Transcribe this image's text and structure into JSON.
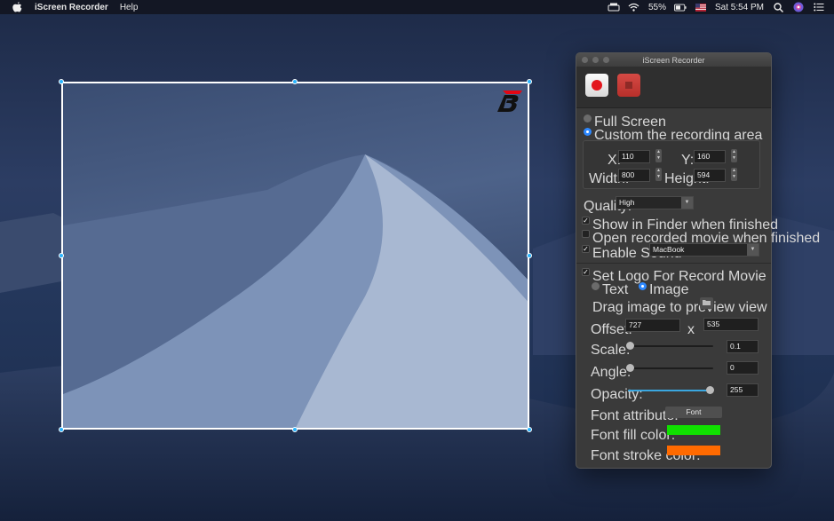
{
  "menubar": {
    "app_name": "iScreen Recorder",
    "menus": [
      "Help"
    ],
    "battery": "55%",
    "clock": "Sat 5:54 PM"
  },
  "window": {
    "title": "iScreen Recorder",
    "mode_full_screen": "Full Screen",
    "mode_custom": "Custom the recording area",
    "mode_selected": "custom",
    "x_label": "X:",
    "x_value": "110",
    "y_label": "Y:",
    "y_value": "160",
    "width_label": "Width:",
    "width_value": "800",
    "height_label": "Height:",
    "height_value": "594",
    "quality_label": "Quality:",
    "quality_value": "High",
    "show_in_finder": "Show in Finder when finished",
    "show_in_finder_checked": true,
    "open_recorded": "Open recorded movie when finished",
    "open_recorded_checked": false,
    "enable_sound": "Enable Sound",
    "enable_sound_checked": true,
    "sound_device": "MacBook",
    "set_logo": "Set Logo For Record Movie",
    "set_logo_checked": true,
    "logo_text": "Text",
    "logo_image": "Image",
    "logo_type_selected": "image",
    "drag_image": "Drag image to preview view",
    "offset_label": "Offset:",
    "offset_x": "727",
    "offset_sep": "x",
    "offset_y": "535",
    "scale_label": "Scale:",
    "scale_value": "0.1",
    "angle_label": "Angle:",
    "angle_value": "0",
    "opacity_label": "Opacity:",
    "opacity_value": "255",
    "font_attr_label": "Font attribute:",
    "font_button": "Font",
    "font_fill_label": "Font fill color:",
    "font_fill_color": "#10e000",
    "font_stroke_label": "Font stroke color:",
    "font_stroke_color": "#ff6a00"
  },
  "colors": {
    "accent": "#2d88ff",
    "record_red": "#e3161d",
    "selection_border": "#ffffff",
    "handle": "#29b5ff"
  },
  "icons": [
    "apple-icon",
    "keyboard-icon",
    "wifi-icon",
    "battery-icon",
    "flag-icon",
    "search-icon",
    "siri-icon",
    "list-icon",
    "record-icon",
    "stop-icon",
    "folder-icon"
  ]
}
